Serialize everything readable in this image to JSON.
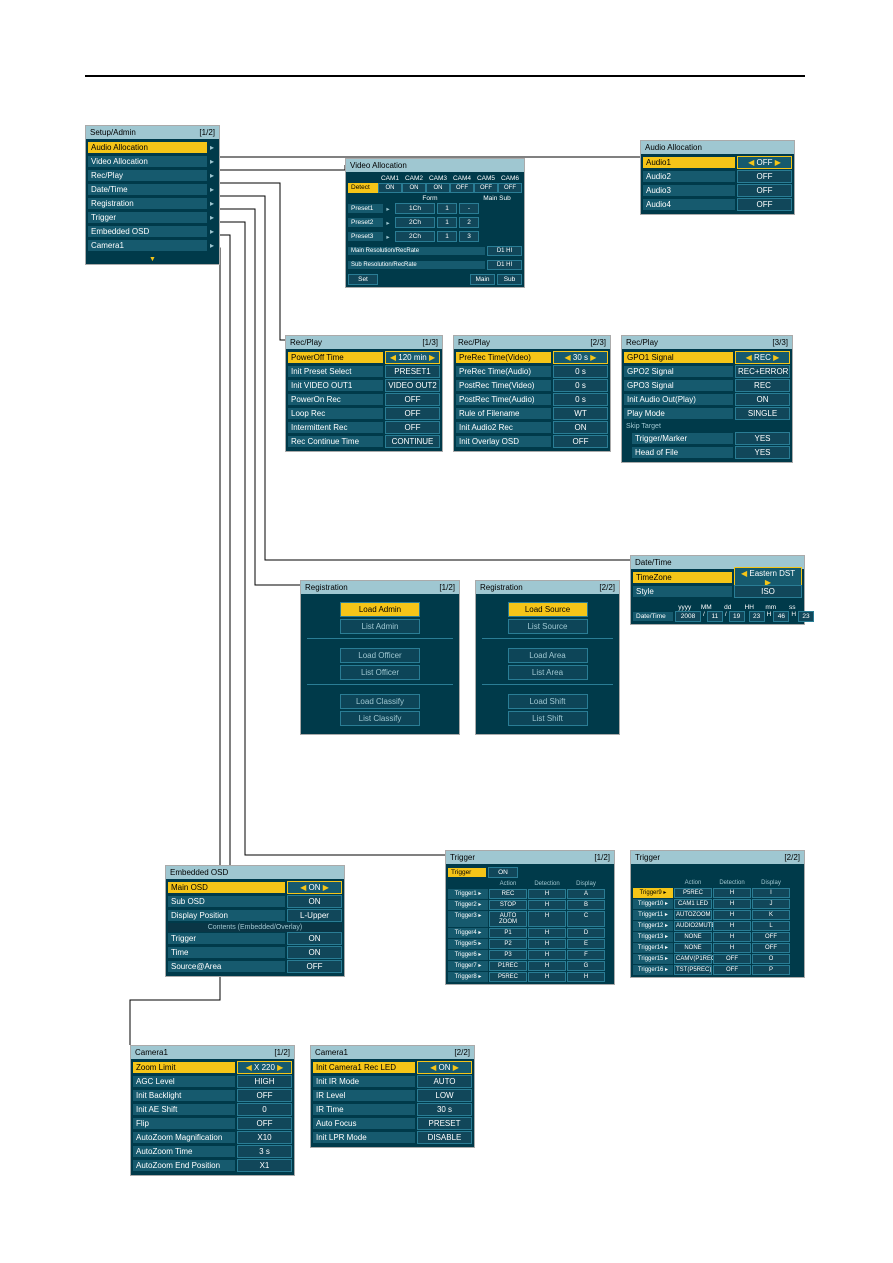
{
  "setup_admin": {
    "title": "Setup/Admin",
    "page": "[1/2]",
    "items": [
      "Audio Allocation",
      "Video Allocation",
      "Rec/Play",
      "Date/Time",
      "Registration",
      "Trigger",
      "Embedded OSD",
      "Camera1"
    ]
  },
  "audio_alloc": {
    "title": "Audio Allocation",
    "rows": [
      {
        "label": "Audio1",
        "val": "OFF",
        "sel": true
      },
      {
        "label": "Audio2",
        "val": "OFF"
      },
      {
        "label": "Audio3",
        "val": "OFF"
      },
      {
        "label": "Audio4",
        "val": "OFF"
      }
    ]
  },
  "video_alloc": {
    "title": "Video Allocation",
    "cams": [
      "CAM1",
      "CAM2",
      "CAM3",
      "CAM4",
      "CAM5",
      "CAM6"
    ],
    "detect_label": "Detect",
    "detect": [
      "ON",
      "ON",
      "ON",
      "OFF",
      "OFF",
      "OFF"
    ],
    "form_hd": "Form",
    "main_hd": "Main",
    "sub_hd": "Sub",
    "presets": [
      {
        "label": "Preset1",
        "form": "1Ch",
        "main": "1",
        "sub": "-"
      },
      {
        "label": "Preset2",
        "form": "2Ch",
        "main": "1",
        "sub": "2"
      },
      {
        "label": "Preset3",
        "form": "2Ch",
        "main": "1",
        "sub": "3"
      }
    ],
    "main_res": "Main Resolution/RecRate",
    "main_res_v": "D1 HI",
    "sub_res": "Sub Resolution/RecRate",
    "sub_res_v": "D1 HI",
    "set": "Set",
    "main_btn": "Main",
    "sub_btn": "Sub"
  },
  "recplay1": {
    "title": "Rec/Play",
    "page": "[1/3]",
    "rows": [
      {
        "label": "PowerOff Time",
        "val": "120 min",
        "sel": true
      },
      {
        "label": "Init Preset Select",
        "val": "PRESET1"
      },
      {
        "label": "Init VIDEO OUT1",
        "val": "VIDEO OUT2"
      },
      {
        "label": "PowerOn Rec",
        "val": "OFF"
      },
      {
        "label": "Loop Rec",
        "val": "OFF"
      },
      {
        "label": "Intermittent Rec",
        "val": "OFF"
      },
      {
        "label": "Rec Continue Time",
        "val": "CONTINUE"
      }
    ]
  },
  "recplay2": {
    "title": "Rec/Play",
    "page": "[2/3]",
    "rows": [
      {
        "label": "PreRec Time(Video)",
        "val": "30 s",
        "sel": true
      },
      {
        "label": "PreRec Time(Audio)",
        "val": "0 s"
      },
      {
        "label": "PostRec Time(Video)",
        "val": "0 s"
      },
      {
        "label": "PostRec Time(Audio)",
        "val": "0 s"
      },
      {
        "label": "Rule of Filename",
        "val": "WT"
      },
      {
        "label": "Init Audio2 Rec",
        "val": "ON"
      },
      {
        "label": "Init Overlay OSD",
        "val": "OFF"
      }
    ]
  },
  "recplay3": {
    "title": "Rec/Play",
    "page": "[3/3]",
    "rows": [
      {
        "label": "GPO1 Signal",
        "val": "REC",
        "sel": true
      },
      {
        "label": "GPO2 Signal",
        "val": "REC+ERROR"
      },
      {
        "label": "GPO3 Signal",
        "val": "REC"
      },
      {
        "label": "Init Audio Out(Play)",
        "val": "ON"
      },
      {
        "label": "Play Mode",
        "val": "SINGLE"
      }
    ],
    "skip": "Skip Target",
    "skip_rows": [
      {
        "label": "Trigger/Marker",
        "val": "YES"
      },
      {
        "label": "Head of File",
        "val": "YES"
      }
    ]
  },
  "reg1": {
    "title": "Registration",
    "page": "[1/2]",
    "btns": [
      "Load Admin",
      "List Admin",
      "Load Officer",
      "List Officer",
      "Load Classify",
      "List Classify"
    ]
  },
  "reg2": {
    "title": "Registration",
    "page": "[2/2]",
    "btns": [
      "Load Source",
      "List Source",
      "Load Area",
      "List Area",
      "Load Shift",
      "List Shift"
    ]
  },
  "datetime": {
    "title": "Date/Time",
    "tz_label": "TimeZone",
    "tz": "Eastern DST",
    "style_label": "Style",
    "style": "ISO",
    "hdr": [
      "yyyy",
      "MM",
      "dd",
      "HH",
      "mm",
      "ss"
    ],
    "dt_label": "Date/Time",
    "dt": [
      "2008",
      "/",
      "11",
      "/",
      "19",
      "",
      "23",
      "H",
      "46",
      "H",
      "23"
    ]
  },
  "embedded": {
    "title": "Embedded OSD",
    "rows": [
      {
        "label": "Main OSD",
        "val": "ON",
        "sel": true
      },
      {
        "label": "Sub OSD",
        "val": "ON"
      },
      {
        "label": "Display Position",
        "val": "L-Upper"
      }
    ],
    "subhd": "Contents (Embedded/Overlay)",
    "rows2": [
      {
        "label": "Trigger",
        "val": "ON"
      },
      {
        "label": "Time",
        "val": "ON"
      },
      {
        "label": "Source@Area",
        "val": "OFF"
      }
    ]
  },
  "trigger1": {
    "title": "Trigger",
    "page": "[1/2]",
    "tg_label": "Trigger",
    "tg_val": "ON",
    "hd": [
      "",
      "Action",
      "Detection",
      "Display"
    ],
    "rows": [
      [
        "Trigger1",
        "REC",
        "H",
        "A"
      ],
      [
        "Trigger2",
        "STOP",
        "H",
        "B"
      ],
      [
        "Trigger3",
        "AUTO ZOOM",
        "H",
        "C"
      ],
      [
        "Trigger4",
        "P1",
        "H",
        "D"
      ],
      [
        "Trigger5",
        "P2",
        "H",
        "E"
      ],
      [
        "Trigger6",
        "P3",
        "H",
        "F"
      ],
      [
        "Trigger7",
        "P1REC",
        "H",
        "G"
      ],
      [
        "Trigger8",
        "P5REC",
        "H",
        "H"
      ]
    ]
  },
  "trigger2": {
    "title": "Trigger",
    "page": "[2/2]",
    "hd": [
      "",
      "Action",
      "Detection",
      "Display"
    ],
    "rows": [
      [
        "Trigger9",
        "P5REC",
        "H",
        "I"
      ],
      [
        "Trigger10",
        "CAM1 LED",
        "H",
        "J"
      ],
      [
        "Trigger11",
        "AUTOZOOM",
        "H",
        "K"
      ],
      [
        "Trigger12",
        "AUDIO2MUTE",
        "H",
        "L"
      ],
      [
        "Trigger13",
        "NONE",
        "H",
        "OFF"
      ],
      [
        "Trigger14",
        "NONE",
        "H",
        "OFF"
      ],
      [
        "Trigger15",
        "CAMV(P1REC)",
        "OFF",
        "O"
      ],
      [
        "Trigger16",
        "TST(P5REC)",
        "OFF",
        "P"
      ]
    ]
  },
  "camera1": {
    "title": "Camera1",
    "page": "[1/2]",
    "rows": [
      {
        "label": "Zoom Limit",
        "val": "X 220",
        "sel": true
      },
      {
        "label": "AGC Level",
        "val": "HIGH"
      },
      {
        "label": "Init Backlight",
        "val": "OFF"
      },
      {
        "label": "Init AE Shift",
        "val": "0"
      },
      {
        "label": "Flip",
        "val": "OFF"
      },
      {
        "label": "AutoZoom Magnification",
        "val": "X10"
      },
      {
        "label": "AutoZoom Time",
        "val": "3 s"
      },
      {
        "label": "AutoZoom End Position",
        "val": "X1"
      }
    ]
  },
  "camera2": {
    "title": "Camera1",
    "page": "[2/2]",
    "rows": [
      {
        "label": "Init Camera1 Rec LED",
        "val": "ON",
        "sel": true
      },
      {
        "label": "Init IR Mode",
        "val": "AUTO"
      },
      {
        "label": "IR Level",
        "val": "LOW"
      },
      {
        "label": "IR Time",
        "val": "30 s"
      },
      {
        "label": "Auto Focus",
        "val": "PRESET"
      },
      {
        "label": "Init LPR Mode",
        "val": "DISABLE"
      }
    ]
  }
}
